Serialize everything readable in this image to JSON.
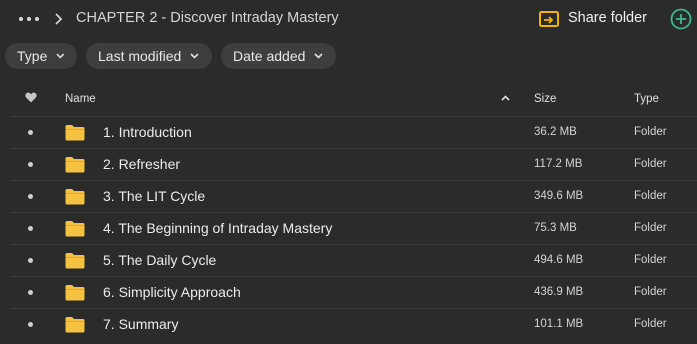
{
  "breadcrumb": {
    "title": "CHAPTER 2 - Discover Intraday Mastery"
  },
  "actions": {
    "share_label": "Share folder"
  },
  "filters": [
    {
      "label": "Type"
    },
    {
      "label": "Last modified"
    },
    {
      "label": "Date added"
    }
  ],
  "columns": {
    "name": "Name",
    "size": "Size",
    "type": "Type"
  },
  "colors": {
    "background": "#2b2b2b",
    "folder": "#f5c342",
    "accent_add": "#3fb68b",
    "share_icon": "#f5b400"
  },
  "rows": [
    {
      "name": "1. Introduction",
      "size": "36.2 MB",
      "type": "Folder"
    },
    {
      "name": "2. Refresher",
      "size": "117.2 MB",
      "type": "Folder"
    },
    {
      "name": "3. The LIT Cycle",
      "size": "349.6 MB",
      "type": "Folder"
    },
    {
      "name": "4. The Beginning of Intraday Mastery",
      "size": "75.3 MB",
      "type": "Folder"
    },
    {
      "name": "5. The Daily Cycle",
      "size": "494.6 MB",
      "type": "Folder"
    },
    {
      "name": "6. Simplicity Approach",
      "size": "436.9 MB",
      "type": "Folder"
    },
    {
      "name": "7. Summary",
      "size": "101.1 MB",
      "type": "Folder"
    }
  ]
}
